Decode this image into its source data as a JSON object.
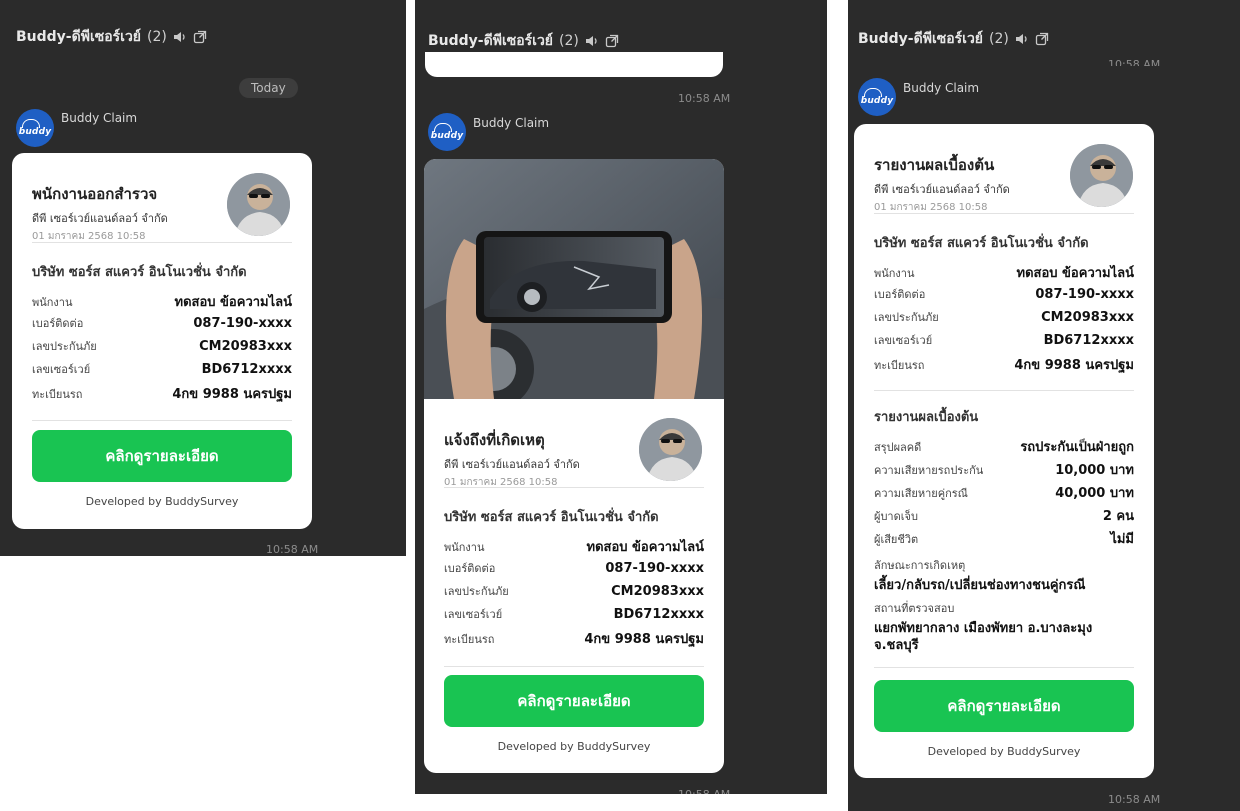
{
  "chat": {
    "title": "Buddy-ดีพีเซอร์เวย์",
    "count": "(2)",
    "today": "Today",
    "sender": "Buddy Claim",
    "logo_text": "buddy",
    "time": "10:58 AM"
  },
  "common": {
    "company": "บริษัท ซอร์ส สแควร์ อินโนเวชั่น จำกัด",
    "subtitle": "ดีพี เซอร์เวย์แอนด์ลอว์ จำกัด",
    "date": "01 มกราคม 2568 10:58",
    "button": "คลิกดูรายละเอียด",
    "developed_by": "Developed by BuddySurvey",
    "rows": [
      {
        "label": "พนักงาน",
        "value": "ทดสอบ ข้อความไลน์"
      },
      {
        "label": "เบอร์ติดต่อ",
        "value": "087-190-xxxx"
      },
      {
        "label": "เลขประกันภัย",
        "value": "CM20983xxx"
      },
      {
        "label": "เลขเซอร์เวย์",
        "value": "BD6712xxxx"
      },
      {
        "label": "ทะเบียนรถ",
        "value": "4กข 9988 นครปฐม"
      }
    ]
  },
  "card1": {
    "title": "พนักงานออกสำรวจ"
  },
  "card2": {
    "title": "แจ้งถึงที่เกิดเหตุ"
  },
  "card3": {
    "title": "รายงานผลเบื้องต้น",
    "section_title": "รายงานผลเบื้องต้น",
    "report_rows": [
      {
        "label": "สรุปผลคดี",
        "value": "รถประกันเป็นฝ่ายถูก"
      },
      {
        "label": "ความเสียหายรถประกัน",
        "value": "10,000 บาท"
      },
      {
        "label": "ความเสียหายคู่กรณี",
        "value": "40,000 บาท"
      },
      {
        "label": "ผู้บาดเจ็บ",
        "value": "2 คน"
      },
      {
        "label": "ผู้เสียชีวิต",
        "value": "ไม่มี"
      }
    ],
    "cause_label": "ลักษณะการเกิดเหตุ",
    "cause_value": "เลี้ยว/กลับรถ/เปลี่ยนช่องทางชนคู่กรณี",
    "location_label": "สถานที่ตรวจสอบ",
    "location_value": "แยกพัทยากลาง เมืองพัทยา อ.บางละมุง จ.ชลบุรี"
  }
}
